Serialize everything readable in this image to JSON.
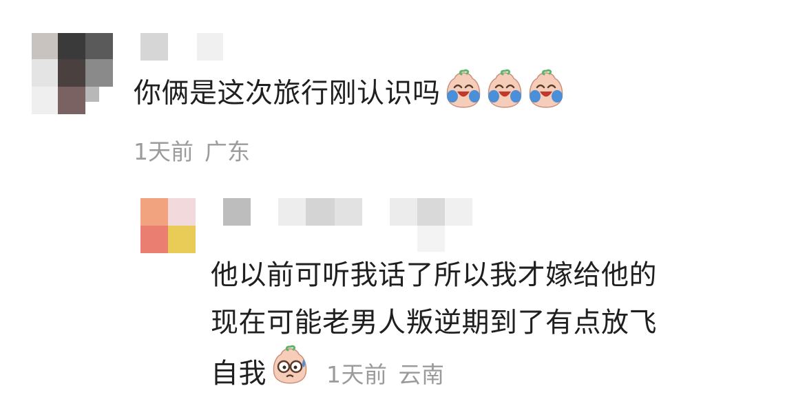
{
  "comments": [
    {
      "text": "你俩是这次旅行刚认识吗",
      "emojis": [
        "laugh-cry-emoji",
        "laugh-cry-emoji",
        "laugh-cry-emoji"
      ],
      "time": "1天前",
      "location": "广东"
    },
    {
      "lines": [
        "他以前可听我话了所以我才嫁给他的",
        "现在可能老男人叛逆期到了有点放飞",
        "自我"
      ],
      "emoji": "nervous-glasses-emoji",
      "time": "1天前",
      "location": "云南"
    }
  ],
  "colors": {
    "text": "#1f1f1f",
    "meta": "#9b9b9b",
    "emoji_face": "#f6cdb8",
    "emoji_tear": "#4a8fd8"
  }
}
